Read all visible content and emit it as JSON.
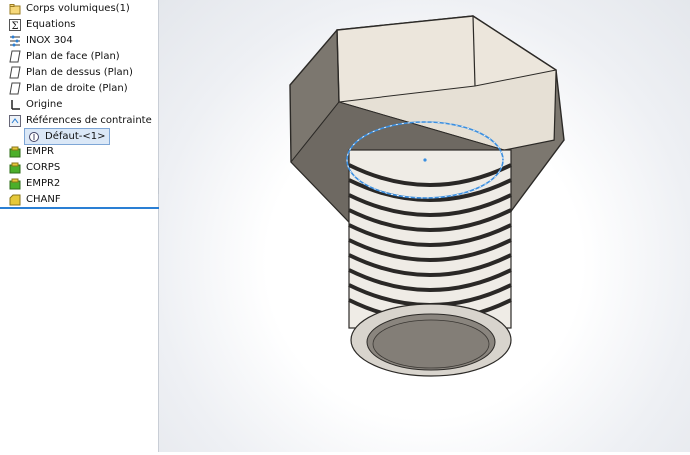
{
  "feature_tree": {
    "items": [
      {
        "label": "Corps volumiques(1)",
        "icon": "solid-bodies-folder-icon"
      },
      {
        "label": "Equations",
        "icon": "equations-icon"
      },
      {
        "label": "INOX 304",
        "icon": "material-icon"
      },
      {
        "label": "Plan de face (Plan)",
        "icon": "plane-icon"
      },
      {
        "label": "Plan de dessus (Plan)",
        "icon": "plane-icon"
      },
      {
        "label": "Plan de droite (Plan)",
        "icon": "plane-icon"
      },
      {
        "label": "Origine",
        "icon": "origin-icon"
      },
      {
        "label": "Références de contrainte",
        "icon": "mate-references-icon"
      },
      {
        "label": "Défaut-<1>",
        "icon": "configuration-icon"
      },
      {
        "label": "EMPR",
        "icon": "feature-icon"
      },
      {
        "label": "CORPS",
        "icon": "feature-icon"
      },
      {
        "label": "EMPR2",
        "icon": "feature-icon"
      },
      {
        "label": "CHANF",
        "icon": "chamfer-icon"
      }
    ]
  },
  "colors": {
    "accent": "#2a7fd4",
    "selection": "#dbe8f7",
    "model_highlight": "#3b8fe0",
    "feature_green": "#4caf2a",
    "feature_yellow": "#e5c83a"
  }
}
